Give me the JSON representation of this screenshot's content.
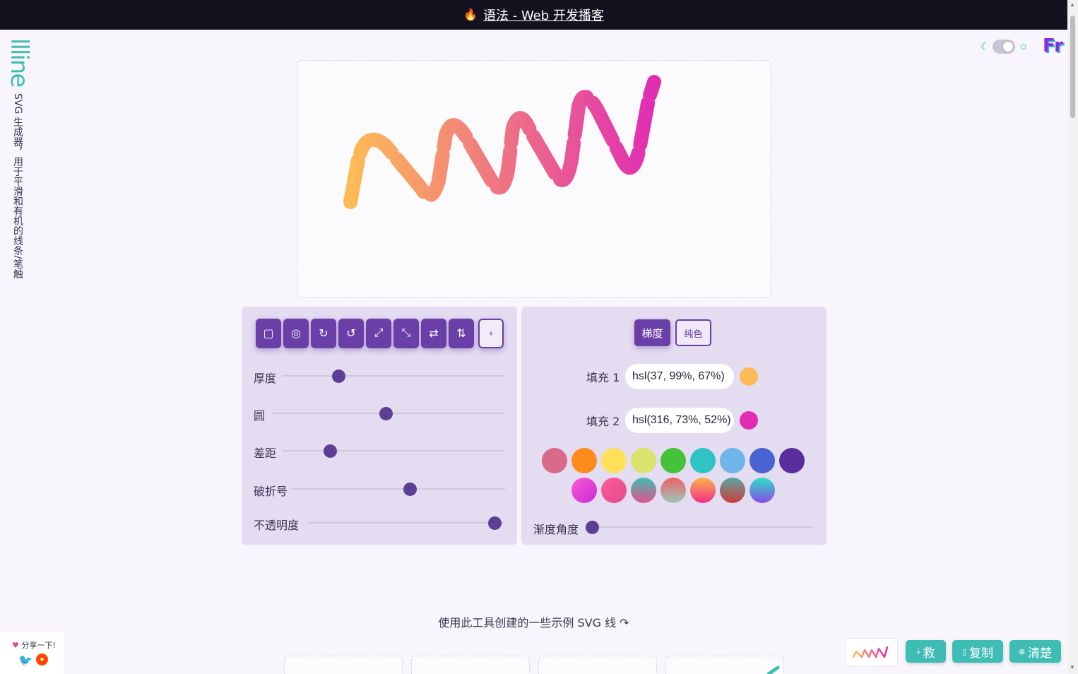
{
  "banner": {
    "icon": "fire-icon",
    "text": "语法 - Web 开发播客"
  },
  "logo": {
    "word": "llline",
    "tagline": "SVG 生成器，用于平滑和有机的线条/笔触"
  },
  "brand": {
    "text": "Fr"
  },
  "theme": {
    "mode": "light"
  },
  "colors": {
    "accent": "#6a3fa8",
    "teal": "#3dbdb4",
    "panel": "#e4dcf1"
  },
  "toolbar": {
    "tools": [
      {
        "icon": "square-icon",
        "glyph": "▢"
      },
      {
        "icon": "target-icon",
        "glyph": "◎"
      },
      {
        "icon": "rotate-cw-icon",
        "glyph": "↻"
      },
      {
        "icon": "rotate-ccw-icon",
        "glyph": "↺"
      },
      {
        "icon": "expand-icon",
        "glyph": "⤢"
      },
      {
        "icon": "shrink-icon",
        "glyph": "⤡"
      },
      {
        "icon": "swap-horizontal-icon",
        "glyph": "⇄"
      },
      {
        "icon": "swap-vertical-icon",
        "glyph": "⇅"
      }
    ],
    "plus_label": "+"
  },
  "sliders": [
    {
      "label": "厚度",
      "value": 0.24
    },
    {
      "label": "圆",
      "value": 0.49
    },
    {
      "label": "差距",
      "value": 0.2
    },
    {
      "label": "破折号",
      "value": 0.56
    },
    {
      "label": "不透明度",
      "value": 0.98
    }
  ],
  "gradient_angle": {
    "label": "渐度角度",
    "value": 0.0
  },
  "fill_mode": {
    "gradient_label": "梯度",
    "solid_label": "纯色",
    "selected": "梯度"
  },
  "fills": [
    {
      "label": "填充 1",
      "value": "hsl(37, 99%, 67%)",
      "color": "#fdbb55"
    },
    {
      "label": "填充 2",
      "value": "hsl(316, 73%, 52%)",
      "color": "#e02db2"
    }
  ],
  "swatches_row1": [
    "#d96a8a",
    "#ff8c1a",
    "#ffe05a",
    "#d8e46a",
    "#45c23a",
    "#2ec4c4",
    "#6fb4ea",
    "#4a63d2",
    "#5a2d9c"
  ],
  "swatches_row2": [
    "pink",
    "rose",
    "teal-rose",
    "coral-teal",
    "orange-pink",
    "teal-red",
    "cyan-purple"
  ],
  "examples": {
    "title": "使用此工具创建的一些示例 SVG 线 ↷"
  },
  "share": {
    "label": "分享一下!",
    "twitter_icon": "twitter-icon",
    "reddit_icon": "reddit-icon"
  },
  "actions": [
    {
      "icon": "download-icon",
      "label": "救"
    },
    {
      "icon": "clipboard-icon",
      "label": "复制"
    },
    {
      "icon": "clear-icon",
      "label": "清楚"
    }
  ]
}
